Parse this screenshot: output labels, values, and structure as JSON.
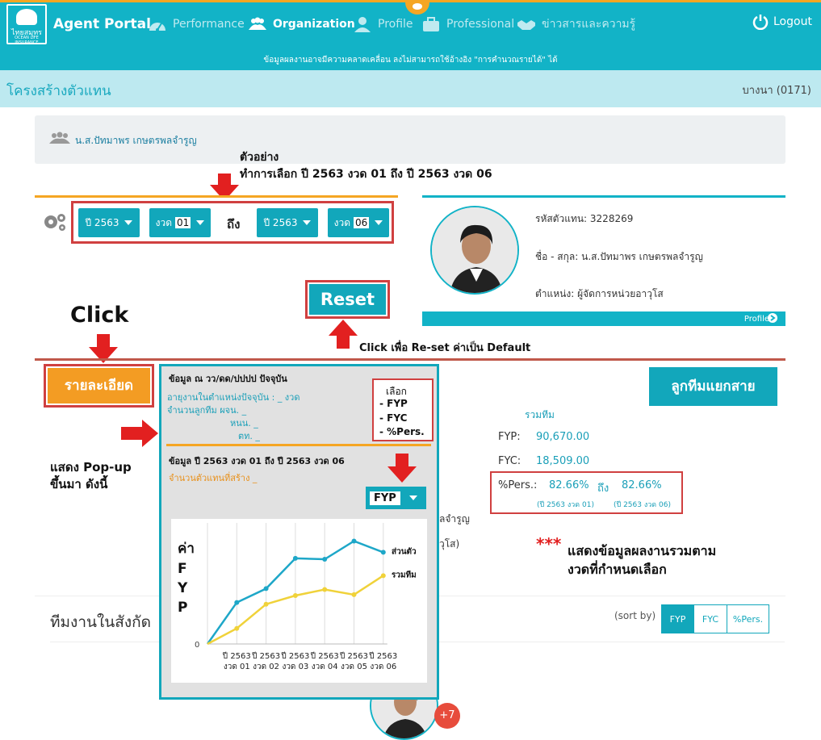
{
  "nav": {
    "logo_line1": "ไทยสมุทร",
    "logo_line2": "OCEAN LIFE INSURANCE",
    "app_name": "Agent Portal",
    "items": [
      {
        "label": "Performance",
        "icon": "dashboard-icon"
      },
      {
        "label": "Organization",
        "icon": "users-icon"
      },
      {
        "label": "Profile",
        "icon": "user-icon"
      },
      {
        "label": "Professional",
        "icon": "briefcase-icon"
      },
      {
        "label": "ข่าวสารและความรู้",
        "icon": "handshake-icon"
      }
    ],
    "logout_label": "Logout"
  },
  "notice": "ข้อมูลผลงานอาจมีความคลาดเคลื่อน ลงไม่สามารถใช้อ้างอิง \"การคำนวณรายได้\" ได้",
  "subheader": {
    "title": "โครงสร้างตัวแทน",
    "branch": "บางนา (0171)"
  },
  "user_bar": {
    "name": "น.ส.ปัทมาพร เกษตรพลจำรูญ"
  },
  "annotations": {
    "example_line1": "ตัวอย่าง",
    "example_line2": "ทำการเลือก ปี 2563 งวด 01 ถึง ปี 2563 งวด 06",
    "click": "Click",
    "reset_note": "Click เพื่อ Re-set ค่าเป็น Default",
    "popup_note_line1": "แสดง Pop-up",
    "popup_note_line2": "ขึ้นมา ดังนี้",
    "stars": "***",
    "summary_note_line1": "แสดงข้อมูลผลงานรวมตาม",
    "summary_note_line2": "งวดที่กำหนดเลือก"
  },
  "filter": {
    "from_year": "ปี 2563",
    "from_period_prefix": "งวด",
    "from_period": "01",
    "to_label": "ถึง",
    "to_year": "ปี 2563",
    "to_period_prefix": "งวด",
    "to_period": "06",
    "reset_label": "Reset"
  },
  "profile": {
    "code_line": "รหัสตัวแทน: 3228269",
    "name_line": "ชื่อ - สกุล: น.ส.ปัทมาพร เกษตรพลจำรูญ",
    "position_line": "ตำแหน่ง: ผู้จัดการหน่วยอาวุโส",
    "footer_label": "Profile"
  },
  "buttons": {
    "detail": "รายละเอียด",
    "split_team": "ลูกทีมแยกสาย"
  },
  "stats": {
    "team_total_label": "รวมทีม",
    "fyp_label": "FYP:",
    "fyp_value": "90,670.00",
    "fyc_label": "FYC:",
    "fyc_value": "18,509.00",
    "pers_label": "%Pers.:",
    "pers_from": "82.66%",
    "pers_to_label": "ถึง",
    "pers_to": "82.66%",
    "pers_from_period": "(ปี 2563 งวด 01)",
    "pers_to_period": "(ปี 2563 งวด 06)",
    "behind_name": "ลจำรูญ",
    "behind_position": "วุโส)"
  },
  "popup": {
    "header": "ข้อมูล ณ วว/ดด/ปปปป ปัจจุบัน",
    "line1": "อายุงานในตำแหน่งปัจจุบัน : _ งวด",
    "line2": "จำนวนลูกทีม ผจน. _",
    "line3": "หนน. _",
    "line4": "ตท. _",
    "select_title": "เลือก",
    "select_options": [
      "- FYP",
      "- FYC",
      "- %Pers."
    ],
    "period_header": "ข้อมูล ปี 2563 งวด 01 ถึง ปี 2563 งวด 06",
    "agents_created": "จำนวนตัวแทนที่สร้าง _",
    "metric_dropdown": "FYP"
  },
  "chart_data": {
    "type": "line",
    "ylabel": "ค่า FYP",
    "categories": [
      "ปี 2563 งวด 01",
      "ปี 2563 งวด 02",
      "ปี 2563 งวด 03",
      "ปี 2563 งวด 04",
      "ปี 2563 งวด 05",
      "ปี 2563 งวด 06"
    ],
    "series": [
      {
        "name": "ส่วนตัว",
        "color": "#1ea7c8",
        "values": [
          48,
          64,
          99,
          98,
          119,
          106
        ]
      },
      {
        "name": "รวมทีม",
        "color": "#f0d23a",
        "values": [
          18,
          46,
          56,
          63,
          57,
          79
        ]
      }
    ],
    "y_origin_label": "0",
    "ylim": [
      0,
      140
    ]
  },
  "team": {
    "title": "ทีมงานในสังกัด",
    "sort_label": "(sort by)",
    "sort_options": [
      "FYP",
      "FYC",
      "%Pers."
    ],
    "badge": "+7"
  }
}
